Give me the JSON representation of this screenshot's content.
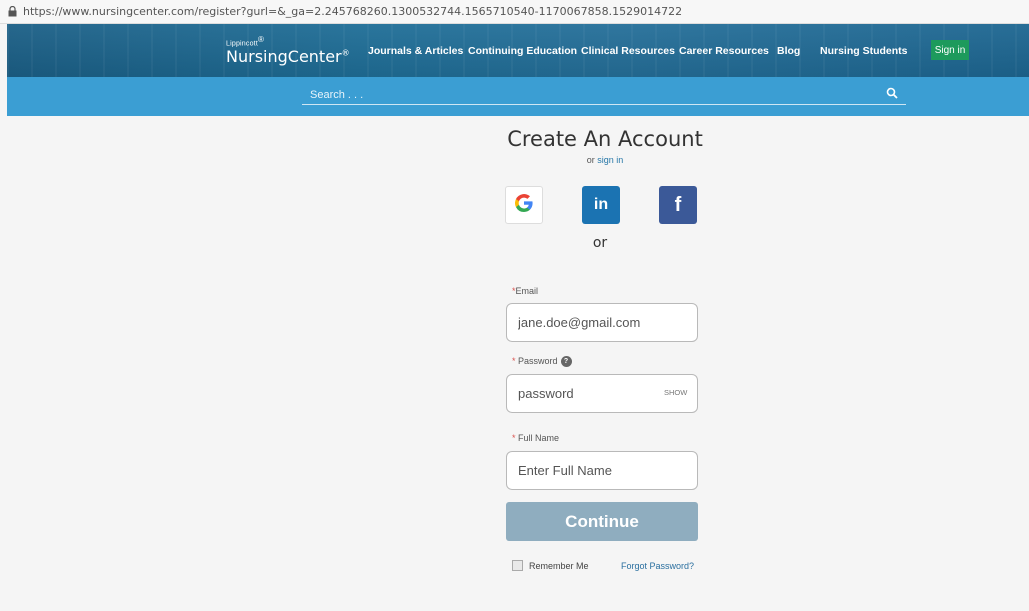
{
  "browser": {
    "url": "https://www.nursingcenter.com/register?gurl=&_ga=2.245768260.1300532744.1565710540-1170067858.1529014722"
  },
  "header": {
    "logo_small": "Lippincott",
    "logo_big": "NursingCenter",
    "nav": [
      {
        "label": "Journals & Articles"
      },
      {
        "label": "Continuing Education"
      },
      {
        "label": "Clinical Resources"
      },
      {
        "label": "Career Resources"
      },
      {
        "label": "Blog"
      },
      {
        "label": "Nursing Students"
      }
    ],
    "signin_label": "Sign in"
  },
  "search": {
    "placeholder": "Search . . .",
    "icon": "search-icon"
  },
  "form": {
    "title": "Create An Account",
    "or_text": "or",
    "signin_link": "sign in",
    "social": [
      {
        "name": "google-icon",
        "label": "G"
      },
      {
        "name": "linkedin-icon",
        "label": "in"
      },
      {
        "name": "facebook-icon",
        "label": "f"
      }
    ],
    "or_divider": "or",
    "email_label": "Email",
    "email_placeholder": "jane.doe@gmail.com",
    "password_label": "Password",
    "password_placeholder": "password",
    "password_show": "SHOW",
    "fullname_label": "Full Name",
    "fullname_placeholder": "Enter Full Name",
    "continue_label": "Continue",
    "remember_label": "Remember Me",
    "forgot_label": "Forgot Password?"
  },
  "colors": {
    "header_bg": "#1f6e97",
    "search_bg": "#3b9ed3",
    "signin_bg": "#1d9a5c",
    "continue_bg": "#8fadbf",
    "linkedin": "#1b73b2",
    "facebook": "#3b5998"
  }
}
